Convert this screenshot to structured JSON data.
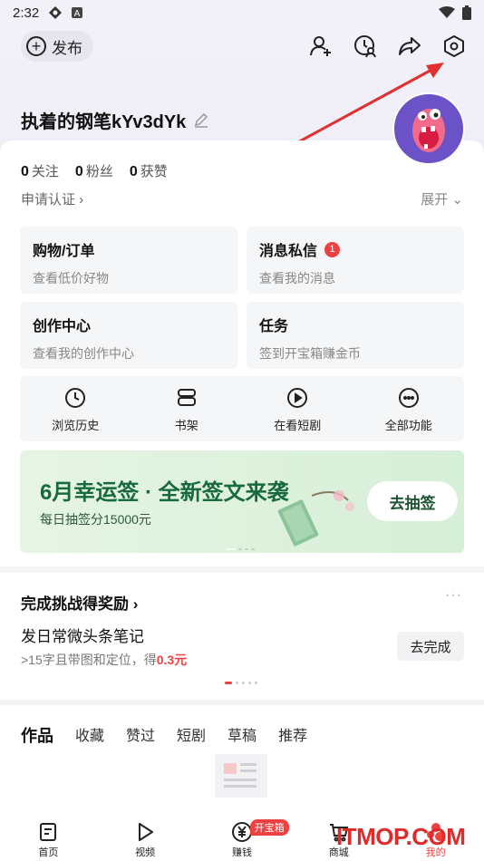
{
  "status_bar": {
    "time": "2:32"
  },
  "header": {
    "publish_label": "发布"
  },
  "profile": {
    "username": "执着的钢笔kYv3dYk",
    "stats": [
      {
        "value": "0",
        "label": "关注"
      },
      {
        "value": "0",
        "label": "粉丝"
      },
      {
        "value": "0",
        "label": "获赞"
      }
    ],
    "cert_link": "申请认证 ›",
    "expand_label": "展开 ⌄"
  },
  "tiles": [
    {
      "title": "购物/订单",
      "sub": "查看低价好物"
    },
    {
      "title": "消息私信",
      "sub": "查看我的消息",
      "badge": "1"
    },
    {
      "title": "创作中心",
      "sub": "查看我的创作中心"
    },
    {
      "title": "任务",
      "sub": "签到开宝箱赚金币"
    }
  ],
  "quick_actions": [
    {
      "label": "浏览历史",
      "icon": "clock-icon"
    },
    {
      "label": "书架",
      "icon": "bookshelf-icon"
    },
    {
      "label": "在看短剧",
      "icon": "play-circle-icon"
    },
    {
      "label": "全部功能",
      "icon": "more-circle-icon"
    }
  ],
  "banner": {
    "title": "6月幸运签 · 全新签文来袭",
    "subtitle": "每日抽签分15000元",
    "button": "去抽签"
  },
  "challenge": {
    "title": "完成挑战得奖励 ›",
    "more": "···",
    "task": "发日常微头条笔记",
    "desc_prefix": ">15字且带图和定位，得",
    "desc_reward": "0.3元",
    "button": "去完成"
  },
  "works_tabs": [
    "作品",
    "收藏",
    "赞过",
    "短剧",
    "草稿",
    "推荐"
  ],
  "bottom_nav": [
    {
      "label": "首页",
      "icon": "home-doc-icon"
    },
    {
      "label": "视频",
      "icon": "play-icon"
    },
    {
      "label": "赚钱",
      "icon": "yuan-icon",
      "badge": "开宝箱"
    },
    {
      "label": "商城",
      "icon": "cart-icon"
    },
    {
      "label": "我的",
      "icon": "profile-icon"
    }
  ],
  "watermark": "ITMOP.COM",
  "colors": {
    "accent_red": "#f04142",
    "banner_green": "#176a3c",
    "avatar_purple": "#6b52c6"
  }
}
